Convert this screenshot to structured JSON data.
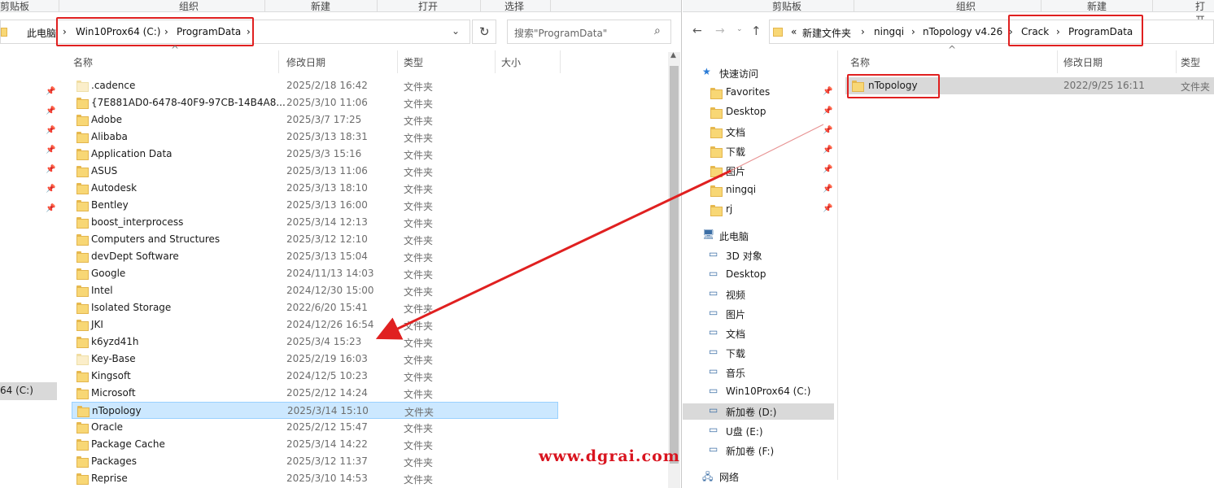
{
  "left": {
    "ribbon": [
      "剪贴板",
      "组织",
      "新建",
      "打开",
      "选择"
    ],
    "address": {
      "root": "此电脑",
      "seg1": "Win10Prox64 (C:)",
      "seg2": "ProgramData"
    },
    "search_placeholder": "搜索\"ProgramData\"",
    "columns": {
      "name": "名称",
      "date": "修改日期",
      "type": "类型",
      "size": "大小"
    },
    "nav_drive": "64 (C:)",
    "rows": [
      {
        "name": ".cadence",
        "date": "2025/2/18 16:42",
        "type": "文件夹"
      },
      {
        "name": "{7E881AD0-6478-40F9-97CB-14B4A8...",
        "date": "2025/3/10 11:06",
        "type": "文件夹"
      },
      {
        "name": "Adobe",
        "date": "2025/3/7 17:25",
        "type": "文件夹"
      },
      {
        "name": "Alibaba",
        "date": "2025/3/13 18:31",
        "type": "文件夹"
      },
      {
        "name": "Application Data",
        "date": "2025/3/3 15:16",
        "type": "文件夹"
      },
      {
        "name": "ASUS",
        "date": "2025/3/13 11:06",
        "type": "文件夹"
      },
      {
        "name": "Autodesk",
        "date": "2025/3/13 18:10",
        "type": "文件夹"
      },
      {
        "name": "Bentley",
        "date": "2025/3/13 16:00",
        "type": "文件夹"
      },
      {
        "name": "boost_interprocess",
        "date": "2025/3/14 12:13",
        "type": "文件夹"
      },
      {
        "name": "Computers and Structures",
        "date": "2025/3/12 12:10",
        "type": "文件夹"
      },
      {
        "name": "devDept Software",
        "date": "2025/3/13 15:04",
        "type": "文件夹"
      },
      {
        "name": "Google",
        "date": "2024/11/13 14:03",
        "type": "文件夹"
      },
      {
        "name": "Intel",
        "date": "2024/12/30 15:00",
        "type": "文件夹"
      },
      {
        "name": "Isolated Storage",
        "date": "2022/6/20 15:41",
        "type": "文件夹"
      },
      {
        "name": "JKI",
        "date": "2024/12/26 16:54",
        "type": "文件夹"
      },
      {
        "name": "k6yzd41h",
        "date": "2025/3/4 15:23",
        "type": "文件夹"
      },
      {
        "name": "Key-Base",
        "date": "2025/2/19 16:03",
        "type": "文件夹"
      },
      {
        "name": "Kingsoft",
        "date": "2024/12/5 10:23",
        "type": "文件夹"
      },
      {
        "name": "Microsoft",
        "date": "2025/2/12 14:24",
        "type": "文件夹"
      },
      {
        "name": "nTopology",
        "date": "2025/3/14 15:10",
        "type": "文件夹"
      },
      {
        "name": "Oracle",
        "date": "2025/2/12 15:47",
        "type": "文件夹"
      },
      {
        "name": "Package Cache",
        "date": "2025/3/14 14:22",
        "type": "文件夹"
      },
      {
        "name": "Packages",
        "date": "2025/3/12 11:37",
        "type": "文件夹"
      },
      {
        "name": "Reprise",
        "date": "2025/3/10 14:53",
        "type": "文件夹"
      }
    ]
  },
  "right": {
    "ribbon": [
      "剪贴板",
      "组织",
      "新建",
      "打开"
    ],
    "address": {
      "prefix": "«",
      "seg1": "新建文件夹",
      "seg2": "ningqi",
      "seg3": "nTopology v4.26",
      "seg4": "Crack",
      "seg5": "ProgramData"
    },
    "columns": {
      "name": "名称",
      "date": "修改日期",
      "type": "类型"
    },
    "rows": [
      {
        "name": "nTopology",
        "date": "2022/9/25 16:11",
        "type": "文件夹"
      }
    ],
    "nav": {
      "quick": "快速访问",
      "quick_items": [
        "Favorites",
        "Desktop",
        "文档",
        "下载",
        "图片",
        "ningqi",
        "rj"
      ],
      "pc": "此电脑",
      "pc_items": [
        "3D 对象",
        "Desktop",
        "视频",
        "图片",
        "文档",
        "下载",
        "音乐",
        "Win10Prox64 (C:)",
        "新加卷 (D:)",
        "U盘 (E:)",
        "新加卷 (F:)"
      ],
      "network": "网络"
    }
  },
  "watermark": "www.dgrai.com",
  "colors": {
    "accent": "#e02020",
    "selection": "#cce8ff",
    "folder": "#f8d775"
  }
}
